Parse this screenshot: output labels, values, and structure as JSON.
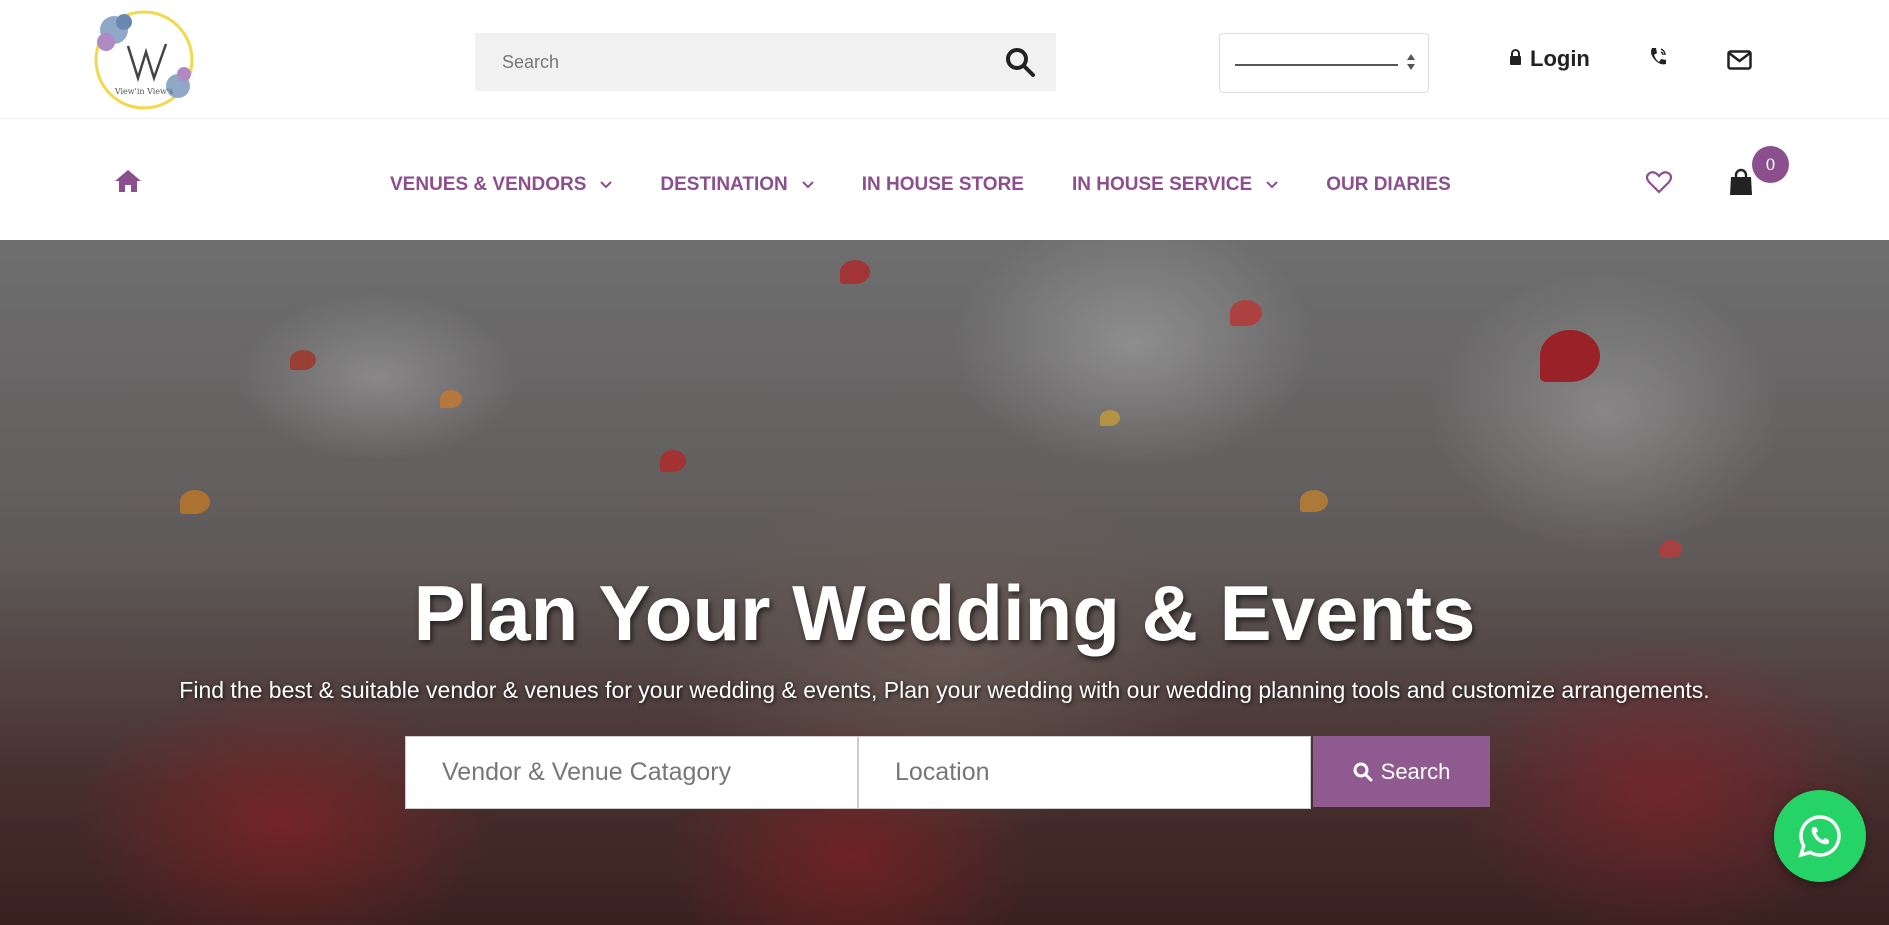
{
  "header": {
    "logo_text": "View'in View's",
    "search_placeholder": "Search",
    "login_label": "Login"
  },
  "nav": {
    "items": [
      {
        "label": "VENUES & VENDORS",
        "has_dropdown": true
      },
      {
        "label": "DESTINATION",
        "has_dropdown": true
      },
      {
        "label": "IN HOUSE STORE",
        "has_dropdown": false
      },
      {
        "label": "IN HOUSE SERVICE",
        "has_dropdown": true
      },
      {
        "label": "OUR DIARIES",
        "has_dropdown": false
      }
    ],
    "cart_count": "0"
  },
  "hero": {
    "title": "Plan Your Wedding & Events",
    "subtitle": "Find the best & suitable vendor & venues for your wedding & events, Plan your wedding with our wedding planning tools and customize arrangements.",
    "category_placeholder": "Vendor & Venue Catagory",
    "location_placeholder": "Location",
    "search_label": "Search"
  },
  "colors": {
    "accent": "#8b4f8e",
    "whatsapp": "#25d366"
  },
  "icons": [
    "logo-icon",
    "search-icon",
    "select-arrows-icon",
    "lock-icon",
    "phone-icon",
    "mail-icon",
    "home-icon",
    "chevron-down-icon",
    "heart-icon",
    "shopping-bag-icon",
    "whatsapp-icon"
  ]
}
